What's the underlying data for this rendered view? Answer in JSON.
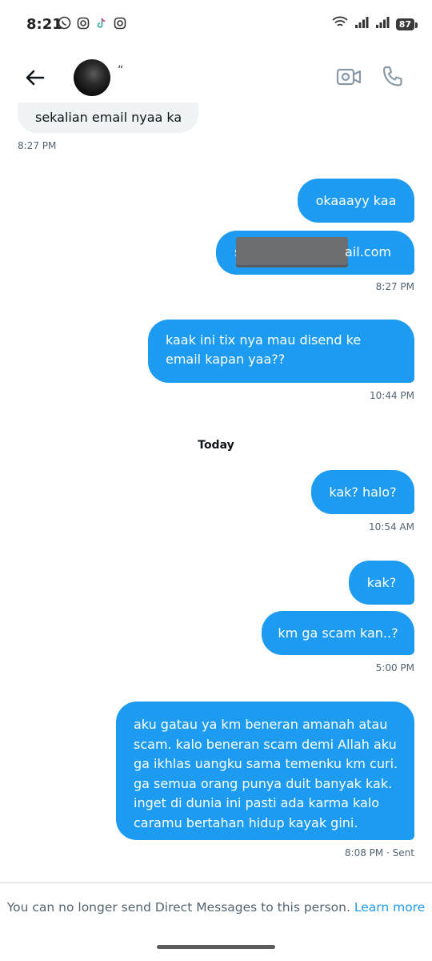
{
  "status_bar": {
    "time": "8:21",
    "battery": "87",
    "left_icons": [
      "whatsapp-icon",
      "instagram-icon",
      "tiktok-icon",
      "instagram-icon"
    ],
    "right_icons": [
      "wifi-icon",
      "signal-icon",
      "signal-icon",
      "battery-icon"
    ]
  },
  "header": {
    "name": "“",
    "back_icon": "arrow-left-icon",
    "video_icon": "video-camera-icon",
    "call_icon": "phone-icon"
  },
  "messages": {
    "m0": {
      "text": "sekalian email nyaa ka",
      "time": "8:27 PM"
    },
    "m1": {
      "text": "okaaayy kaa"
    },
    "m2": {
      "prefix": "s",
      "suffix": "ail.com",
      "time": "8:27 PM"
    },
    "m3": {
      "text": "kaak ini tix nya mau disend ke email kapan yaa??",
      "time": "10:44 PM"
    },
    "day_label": "Today",
    "m4": {
      "text": "kak? halo?",
      "time": "10:54 AM"
    },
    "m5": {
      "text": "kak?"
    },
    "m6": {
      "text": "km ga scam kan..?",
      "time": "5:00 PM"
    },
    "m7": {
      "text": "aku gatau ya km beneran amanah atau scam. kalo beneran scam demi Allah aku ga ikhlas uangku sama temenku km curi. ga semua orang punya duit banyak kak. inget di dunia ini pasti ada karma kalo caramu bertahan hidup kayak gini.",
      "time": "8:08 PM · Sent"
    }
  },
  "footer": {
    "text": "You can no longer send Direct Messages to this person.",
    "link": "Learn more"
  },
  "colors": {
    "accent": "#1d9bf0",
    "incoming_bg": "#eff3f4",
    "muted": "#536471"
  }
}
